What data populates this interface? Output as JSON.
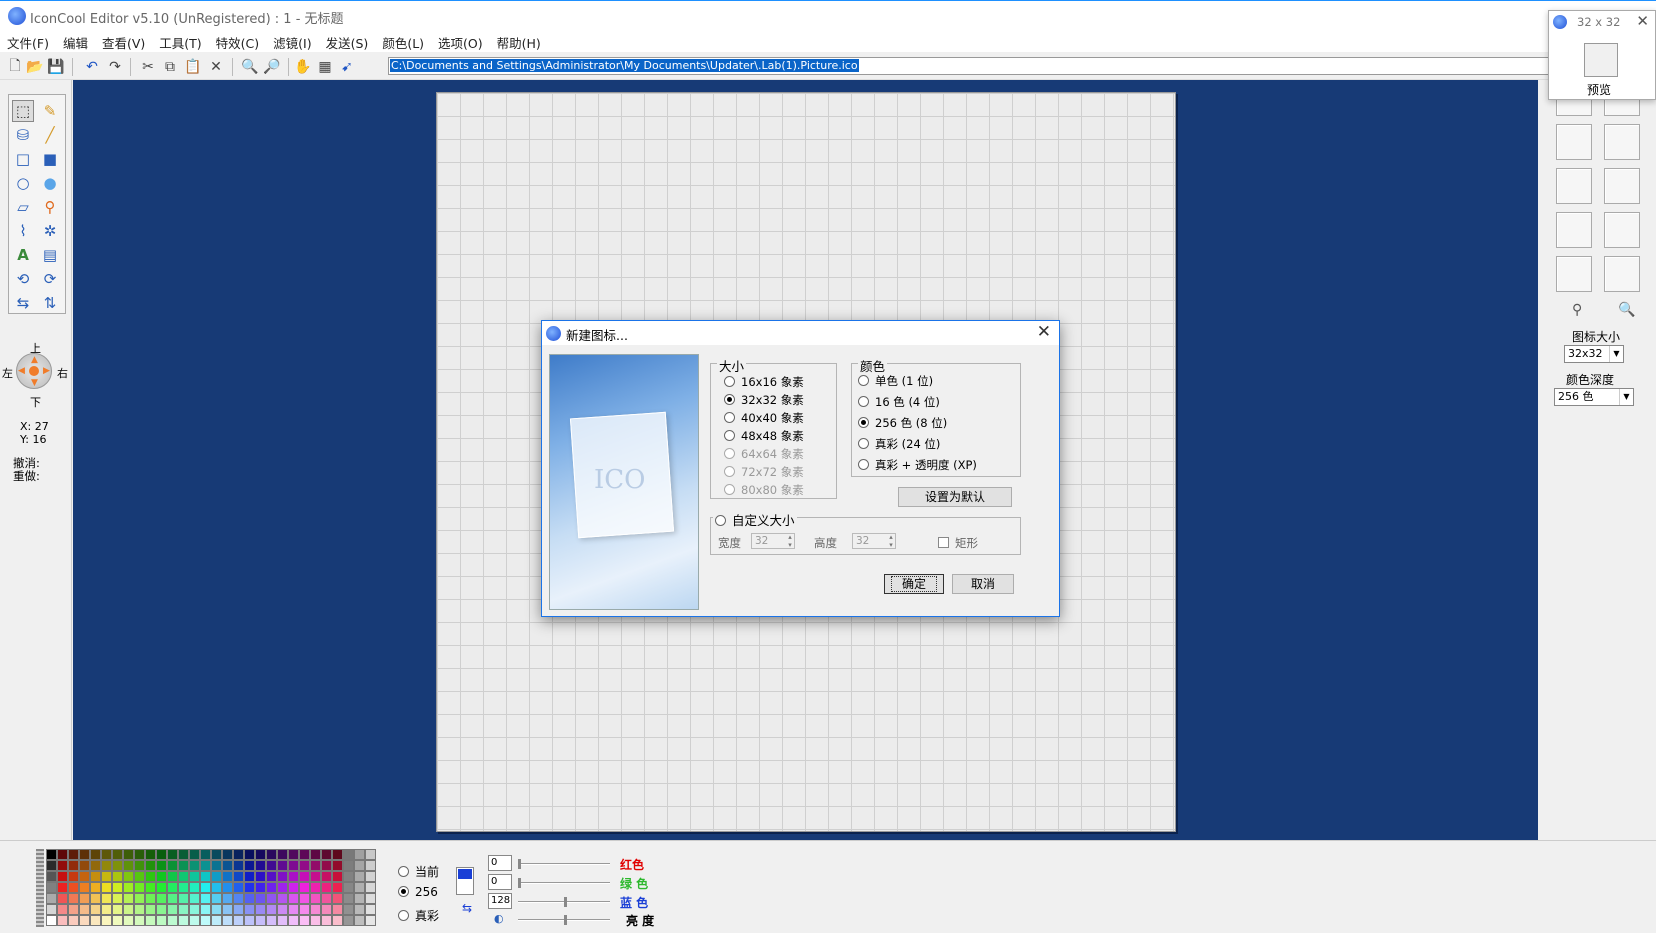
{
  "app": {
    "title": "IconCool Editor v5.10 (UnRegistered) : 1 - 无标题"
  },
  "menu": [
    "文件(F)",
    "编辑",
    "查看(V)",
    "工具(T)",
    "特效(C)",
    "滤镜(I)",
    "发送(S)",
    "颜色(L)",
    "选项(O)",
    "帮助(H)"
  ],
  "toolbar": {
    "path": "C:\\Documents and Settings\\Administrator\\My Documents\\Updater\\.Lab(1).Picture.ico",
    "icons": [
      "new-icon",
      "open-icon",
      "save-icon",
      "undo-icon",
      "redo-icon",
      "cut-icon",
      "copy-icon",
      "paste-icon",
      "delete-icon",
      "zoom-in-icon",
      "zoom-out-icon",
      "hand-icon",
      "film-icon",
      "pointer-icon"
    ]
  },
  "left": {
    "nav": {
      "up": "上",
      "down": "下",
      "left": "左",
      "right": "右"
    },
    "coords": {
      "x": "X: 27",
      "y": "Y: 16"
    },
    "undo": "撤消:",
    "redo": "重做:"
  },
  "preview": {
    "size_title": "32 x 32",
    "label": "预览"
  },
  "right": {
    "icon_size_label": "图标大小",
    "icon_size_value": "32x32",
    "color_depth_label": "颜色深度",
    "color_depth_value": "256 色"
  },
  "dialog": {
    "title": "新建图标...",
    "size_group": "大小",
    "sizes": [
      {
        "label": "16x16 象素",
        "checked": false,
        "disabled": false
      },
      {
        "label": "32x32 象素",
        "checked": true,
        "disabled": false
      },
      {
        "label": "40x40 象素",
        "checked": false,
        "disabled": false
      },
      {
        "label": "48x48 象素",
        "checked": false,
        "disabled": false
      },
      {
        "label": "64x64 象素",
        "checked": false,
        "disabled": true
      },
      {
        "label": "72x72 象素",
        "checked": false,
        "disabled": true
      },
      {
        "label": "80x80 象素",
        "checked": false,
        "disabled": true
      }
    ],
    "color_group": "颜色",
    "colors": [
      {
        "label": "单色 (1 位)",
        "checked": false
      },
      {
        "label": "16 色 (4 位)",
        "checked": false
      },
      {
        "label": "256 色 (8 位)",
        "checked": true
      },
      {
        "label": "真彩 (24 位)",
        "checked": false
      },
      {
        "label": "真彩 + 透明度 (XP)",
        "checked": false
      }
    ],
    "set_default": "设置为默认",
    "custom_group": "自定义大小",
    "width_label": "宽度",
    "width_value": "32",
    "height_label": "高度",
    "height_value": "32",
    "rect_label": "矩形",
    "ok": "确定",
    "cancel": "取消",
    "image_text": "ICO"
  },
  "bottom": {
    "modes": [
      {
        "label": "当前",
        "checked": false
      },
      {
        "label": "256",
        "checked": true
      },
      {
        "label": "真彩",
        "checked": false
      }
    ],
    "channels": [
      {
        "value": "0",
        "label": "红色",
        "color": "#e00000"
      },
      {
        "value": "0",
        "label": "绿 色",
        "color": "#2db82d"
      },
      {
        "value": "128",
        "label": "蓝 色",
        "color": "#1a3fd6"
      },
      {
        "value": "",
        "label": "亮 度",
        "color": "#000000"
      }
    ]
  }
}
